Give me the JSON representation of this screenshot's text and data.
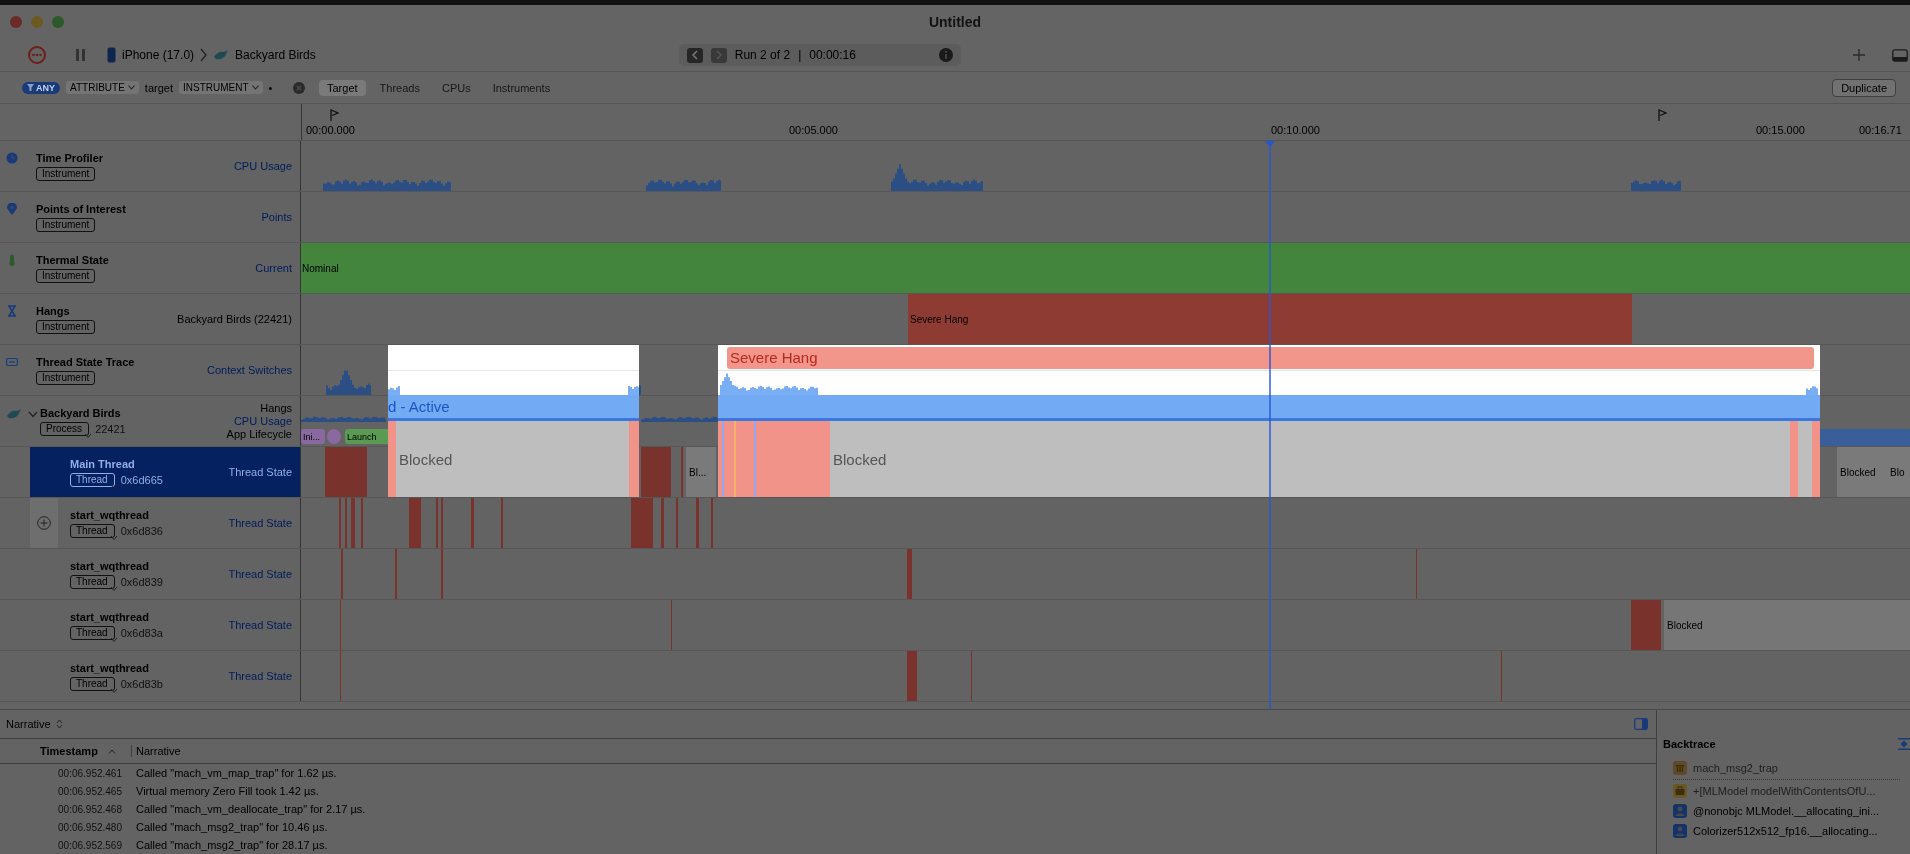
{
  "window": {
    "title": "Untitled"
  },
  "toolbar": {
    "device": "iPhone (17.0)",
    "target": "Backyard Birds",
    "run": "Run 2 of 2",
    "separator": "|",
    "duration": "00:00:16"
  },
  "filter": {
    "tokens": [
      {
        "kind": "pill",
        "text": "ANY"
      },
      {
        "kind": "menu",
        "text": "ATTRIBUTE"
      },
      {
        "kind": "word",
        "text": "target"
      },
      {
        "kind": "menu",
        "text": "INSTRUMENT"
      },
      {
        "kind": "word",
        "text": "•"
      }
    ],
    "scopes": [
      {
        "label": "Target",
        "selected": true
      },
      {
        "label": "Threads",
        "selected": false
      },
      {
        "label": "CPUs",
        "selected": false
      },
      {
        "label": "Instruments",
        "selected": false
      }
    ],
    "duplicate": "Duplicate"
  },
  "ruler": {
    "ticks": [
      "00:00.000",
      "00:05.000",
      "00:10.000",
      "00:15.000",
      "00:16.71"
    ]
  },
  "tracks": [
    {
      "kind": "instrument",
      "title": "Time Profiler",
      "badge": "Instrument",
      "details": [
        {
          "text": "CPU Usage",
          "kind": "link"
        }
      ],
      "lane": {
        "kind": "cpu"
      }
    },
    {
      "kind": "instrument",
      "title": "Points of Interest",
      "badge": "Instrument",
      "details": [
        {
          "text": "Points",
          "kind": "link"
        }
      ],
      "lane": {
        "kind": "empty"
      }
    },
    {
      "kind": "instrument",
      "title": "Thermal State",
      "badge": "Instrument",
      "details": [
        {
          "text": "Current",
          "kind": "link"
        }
      ],
      "lane": {
        "kind": "thermal",
        "label": "Nominal"
      }
    },
    {
      "kind": "instrument",
      "title": "Hangs",
      "badge": "Instrument",
      "details": [
        {
          "text": "Backyard Birds (22421)",
          "kind": "plain"
        }
      ],
      "lane": {
        "kind": "hang",
        "label": "Severe Hang"
      }
    },
    {
      "kind": "instrument",
      "title": "Thread State Trace",
      "badge": "Instrument",
      "details": [
        {
          "text": "Context Switches",
          "kind": "link"
        }
      ],
      "lane": {
        "kind": "cpu2"
      }
    },
    {
      "kind": "process",
      "title": "Backyard Birds",
      "badge": "Process",
      "pid": "22421",
      "expanded": true,
      "details": [
        {
          "text": "Hangs",
          "kind": "plain"
        },
        {
          "text": "CPU Usage",
          "kind": "link"
        },
        {
          "text": "App Lifecycle",
          "kind": "plain"
        }
      ],
      "lane": {
        "kind": "process",
        "labels": [
          "Ini...",
          "Launch"
        ]
      }
    },
    {
      "kind": "thread",
      "title": "Main Thread",
      "badge": "Thread",
      "address": "0x6d665",
      "selected": true,
      "add_button": false,
      "details": [
        {
          "text": "Thread State",
          "kind": "link"
        }
      ],
      "lane": {
        "kind": "main",
        "labels": [
          "Bl...",
          "Blocked",
          "Blo"
        ]
      }
    },
    {
      "kind": "thread",
      "title": "start_wqthread",
      "badge": "Thread",
      "address": "0x6d836",
      "selected": false,
      "add_button": true,
      "details": [
        {
          "text": "Thread State",
          "kind": "link"
        }
      ],
      "lane": {
        "kind": "t1"
      }
    },
    {
      "kind": "thread",
      "title": "start_wqthread",
      "badge": "Thread",
      "address": "0x6d839",
      "selected": false,
      "add_button": false,
      "details": [
        {
          "text": "Thread State",
          "kind": "link"
        }
      ],
      "lane": {
        "kind": "t2"
      }
    },
    {
      "kind": "thread",
      "title": "start_wqthread",
      "badge": "Thread",
      "address": "0x6d83a",
      "selected": false,
      "add_button": false,
      "details": [
        {
          "text": "Thread State",
          "kind": "link"
        }
      ],
      "lane": {
        "kind": "t3",
        "labels": [
          "Blocked"
        ]
      }
    },
    {
      "kind": "thread",
      "title": "start_wqthread",
      "badge": "Thread",
      "address": "0x6d83b",
      "selected": false,
      "add_button": false,
      "details": [
        {
          "text": "Thread State",
          "kind": "link"
        }
      ],
      "lane": {
        "kind": "t4"
      }
    }
  ],
  "spotlights": [
    {
      "active": "d - Active",
      "blocked": "Blocked"
    },
    {
      "hang": "Severe Hang",
      "blocked": "Blocked"
    }
  ],
  "narrative": {
    "selector": "Narrative",
    "columns": [
      "Timestamp",
      "Narrative"
    ],
    "rows": [
      {
        "timestamp": "00:06.952.461",
        "text": "Called \"mach_vm_map_trap\" for 1.62 µs."
      },
      {
        "timestamp": "00:06.952.465",
        "text": "Virtual memory Zero Fill took 1.42 µs."
      },
      {
        "timestamp": "00:06.952.468",
        "text": "Called \"mach_vm_deallocate_trap\" for 2.17 µs."
      },
      {
        "timestamp": "00:06.952.480",
        "text": "Called \"mach_msg2_trap\" for 10.46 µs."
      },
      {
        "timestamp": "00:06.952.569",
        "text": "Called \"mach_msg2_trap\" for 28.17 µs."
      }
    ]
  },
  "backtrace": {
    "title": "Backtrace",
    "frames": [
      {
        "kind": "library",
        "text": "mach_msg2_trap"
      },
      {
        "kind": "framework",
        "text": "+[MLModel modelWithContentsOfU..."
      },
      {
        "kind": "user",
        "text": "@nonobjc MLModel.__allocating_ini..."
      },
      {
        "kind": "user",
        "text": "Colorizer512x512_fp16.__allocating..."
      }
    ]
  }
}
